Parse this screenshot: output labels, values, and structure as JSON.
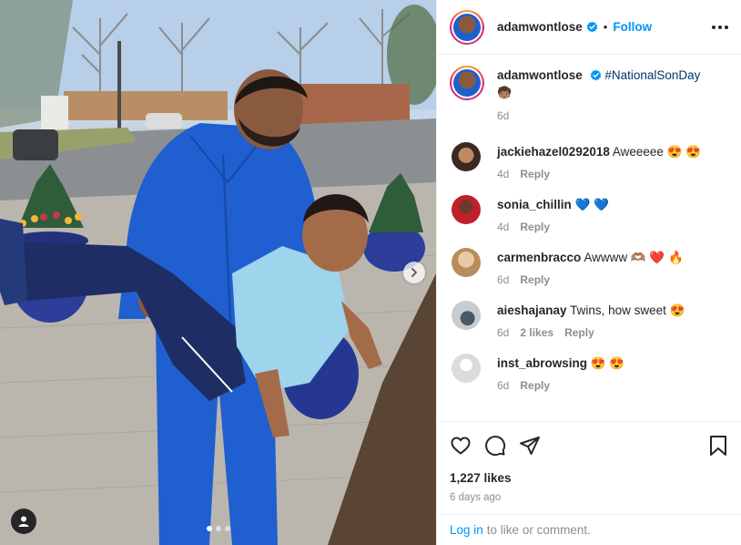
{
  "post": {
    "username": "adamwontlose",
    "follow_label": "Follow",
    "bullet": "•",
    "verified": true
  },
  "caption": {
    "username": "adamwontlose",
    "hashtag": "#NationalSonDay",
    "emoji": "🧒🏽",
    "time": "6d"
  },
  "comments": [
    {
      "username": "jackiehazel0292018",
      "text": "Aweeeee 😍 😍",
      "time": "4d",
      "likes": "",
      "reply_label": "Reply",
      "avatar_color": "#6b4632"
    },
    {
      "username": "sonia_chillin",
      "text": "💙 💙",
      "time": "4d",
      "likes": "",
      "reply_label": "Reply",
      "avatar_color": "#c0202a"
    },
    {
      "username": "carmenbracco",
      "text": "Awwww 🫶🏽 ❤️ 🔥",
      "time": "6d",
      "likes": "",
      "reply_label": "Reply",
      "avatar_color": "#d9c2a8"
    },
    {
      "username": "aieshajanay",
      "text": "Twins, how sweet 😍",
      "time": "6d",
      "likes": "2 likes",
      "reply_label": "Reply",
      "avatar_color": "#9aa7b2"
    },
    {
      "username": "inst_abrowsing",
      "text": "😍 😍",
      "time": "6d",
      "likes": "",
      "reply_label": "Reply",
      "avatar_color": "#dbdbdb"
    }
  ],
  "engagement": {
    "likes": "1,227 likes",
    "time_ago": "6 days ago"
  },
  "login": {
    "link_label": "Log in",
    "rest": "to like or comment."
  },
  "carousel": {
    "count": 3,
    "active_index": 0
  },
  "icons": {
    "more": "more-options-icon",
    "like": "heart-icon",
    "comment": "comment-icon",
    "share": "share-icon",
    "save": "bookmark-icon",
    "next": "chevron-right-icon",
    "tagged": "user-tag-icon"
  },
  "colors": {
    "accent": "#0095f6",
    "hashtag": "#00376b",
    "muted": "#8e8e8e",
    "jumpsuit": "#1f5fd0",
    "kid_shirt": "#9ed4ec"
  }
}
